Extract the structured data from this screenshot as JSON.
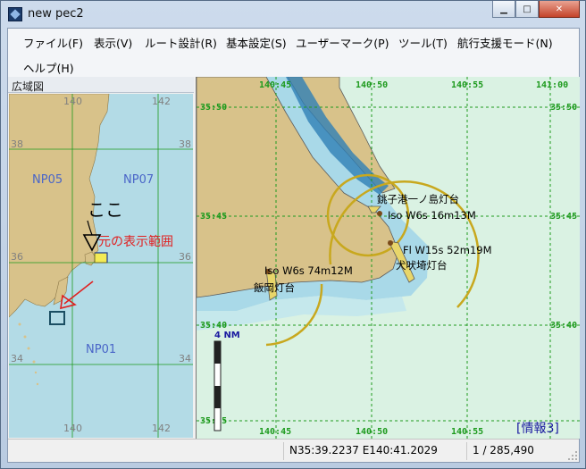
{
  "window": {
    "title": "new pec2"
  },
  "menu": [
    "ファイル(F)",
    "表示(V)",
    "ルート設計(R)",
    "基本設定(S)",
    "ユーザーマーク(P)",
    "ツール(T)",
    "航行支援モード(N)",
    "ヘルプ(H)"
  ],
  "overview": {
    "title": "広域図",
    "chart_labels": [
      "NP05",
      "NP07",
      "NP01"
    ],
    "longitudes": [
      "140",
      "142"
    ],
    "latitudes": [
      "38",
      "36",
      "34"
    ],
    "annotation_here": "ここ",
    "annotation_range": "元の表示範囲"
  },
  "main_map": {
    "longitude_labels": [
      "140:45",
      "140:50",
      "140:55",
      "141:00"
    ],
    "latitude_labels": [
      "35:50",
      "35:45",
      "35:40",
      "35:35"
    ],
    "lighthouses": [
      {
        "name": "銚子港一ノ島灯台",
        "light": "Iso W6s 16m13M"
      },
      {
        "name": "犬吠埼灯台",
        "light": "Fl W15s 52m19M"
      },
      {
        "name": "飯岡灯台",
        "light": "Iso W6s 74m12M"
      }
    ],
    "scale_label": "4 NM",
    "info_label": "[情報3]"
  },
  "status": {
    "position": "N35:39.2237 E140:41.2029",
    "scale": "1 / 285,490"
  },
  "colors": {
    "land": "#d8c28a",
    "shallow_water": "#a9d9e8",
    "deep_water": "#daf2e3",
    "grid_green": "#1d9a1d",
    "info_blue": "#1a1aa0"
  }
}
